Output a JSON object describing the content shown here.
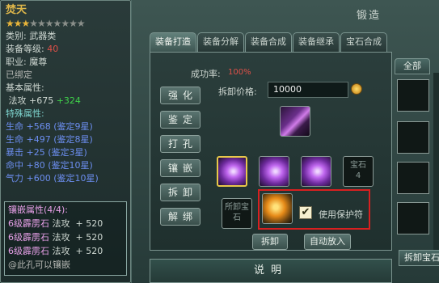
{
  "item": {
    "name": "焚天",
    "stars_on": "★★★",
    "stars_off": "★★★★★★★",
    "type": "类别: 武器类",
    "level_label": "装备等级: ",
    "level_value": "40",
    "job": "职业: 魔尊",
    "bound": "已绑定",
    "base_header": "基本属性:",
    "base_attr_label": "法攻 +675 ",
    "base_attr_bonus": "+324",
    "special_header": "特殊属性:",
    "special": [
      {
        "text": "生命 +568",
        "note": "(鉴定9星)"
      },
      {
        "text": "生命 +497",
        "note": "(鉴定8星)"
      },
      {
        "text": "暴击 +25",
        "note": "(鉴定3星)"
      },
      {
        "text": "命中 +80",
        "note": "(鉴定10星)"
      },
      {
        "text": "气力 +600",
        "note": "(鉴定10星)"
      }
    ],
    "gem_header": "镶嵌属性(4/4):",
    "gems": [
      {
        "gem": "6级霹雳石",
        "attr": "法攻",
        "value": "+ 520"
      },
      {
        "gem": "6级霹雳石",
        "attr": "法攻",
        "value": "+ 520"
      },
      {
        "gem": "6级霹雳石",
        "attr": "法攻",
        "value": "+ 520"
      }
    ],
    "gem_footer": "@此孔可以镶嵌"
  },
  "window": {
    "title": "锻造",
    "tabs": [
      "装备打造",
      "装备分解",
      "装备合成",
      "装备继承",
      "宝石合成"
    ],
    "side_buttons": [
      "强化",
      "鉴定",
      "打孔",
      "镶嵌",
      "拆卸",
      "解绑"
    ],
    "success_label": "成功率:",
    "success_value": "100%",
    "price_label": "拆卸价格:",
    "price_value": "10000",
    "empty_gem_slot": "宝石",
    "empty_gem_index": "4",
    "protect_slot_label": "所卸宝石",
    "protect_check": "✔",
    "protect_label": "使用保护符",
    "btn_remove": "拆卸",
    "btn_auto": "自动放入",
    "explain": "说明",
    "right_tab": "全部",
    "right_bottom_tab": "拆卸宝石"
  }
}
